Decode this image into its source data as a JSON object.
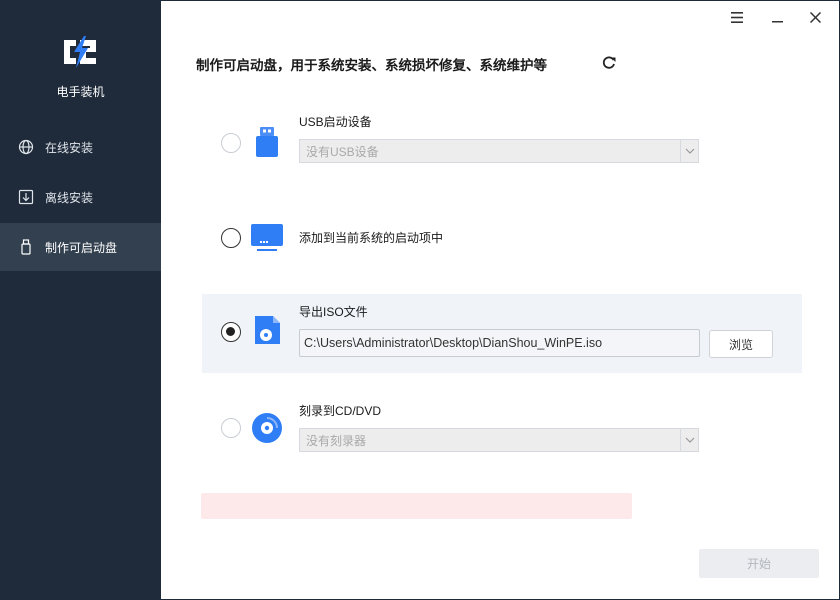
{
  "app": {
    "name": "电手装机"
  },
  "sidebar": {
    "items": [
      {
        "label": "在线安装",
        "icon": "globe-icon"
      },
      {
        "label": "离线安装",
        "icon": "download-box-icon"
      },
      {
        "label": "制作可启动盘",
        "icon": "usb-drive-icon",
        "active": true
      }
    ]
  },
  "window_controls": {
    "menu": "menu-icon",
    "minimize": "minimize-icon",
    "close": "close-icon"
  },
  "main": {
    "heading": "制作可启动盘，用于系统安装、系统损坏修复、系统维护等",
    "options": [
      {
        "label": "USB启动设备",
        "select_value": "没有USB设备",
        "selected": false,
        "icon": "usb-icon"
      },
      {
        "label": "添加到当前系统的启动项中",
        "selected": false,
        "icon": "monitor-icon"
      },
      {
        "label": "导出ISO文件",
        "path_value": "C:\\Users\\Administrator\\Desktop\\DianShou_WinPE.iso",
        "browse_label": "浏览",
        "selected": true,
        "icon": "iso-file-icon"
      },
      {
        "label": "刻录到CD/DVD",
        "select_value": "没有刻录器",
        "selected": false,
        "icon": "disc-icon"
      }
    ],
    "start_label": "开始"
  },
  "colors": {
    "sidebar_bg": "#1f2b3b",
    "sidebar_active": "#33404f",
    "accent": "#2f7ef5",
    "error_bg": "#fde9ea"
  }
}
